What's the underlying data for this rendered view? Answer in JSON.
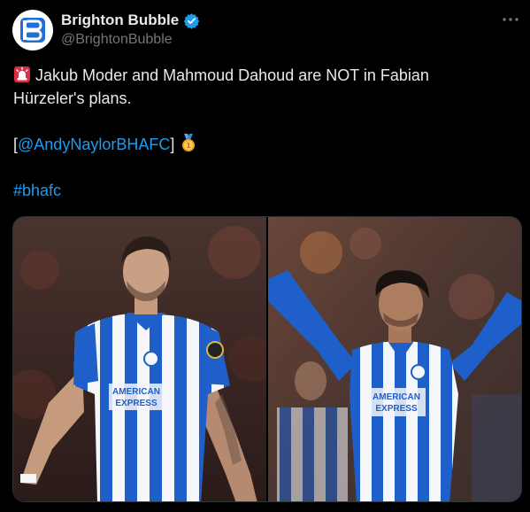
{
  "author": {
    "display_name": "Brighton Bubble",
    "handle": "@BrightonBubble",
    "verified": true,
    "avatar_monogram": "BB"
  },
  "tweet": {
    "line1_emoji": "siren-icon",
    "line1": "Jakub Moder and Mahmoud Dahoud are NOT in Fabian",
    "line2": "Hürzeler's plans.",
    "source_open": "[",
    "source_link": "@AndyNaylorBHAFC",
    "source_close": "]",
    "source_emoji": "medal-icon",
    "hashtag": "#bhafc"
  },
  "media": {
    "photos": [
      {
        "subject": "player-left",
        "shirt_sponsor": [
          "AMERICAN",
          "EXPRESS"
        ]
      },
      {
        "subject": "player-right",
        "shirt_sponsor": [
          "AMERICAN",
          "EXPRESS"
        ]
      }
    ]
  },
  "colors": {
    "background": "#000000",
    "text": "#e7e9ea",
    "secondary": "#71767b",
    "link": "#1d9bf0",
    "kit_blue": "#1e5fc9",
    "kit_white": "#f4f6fa"
  }
}
